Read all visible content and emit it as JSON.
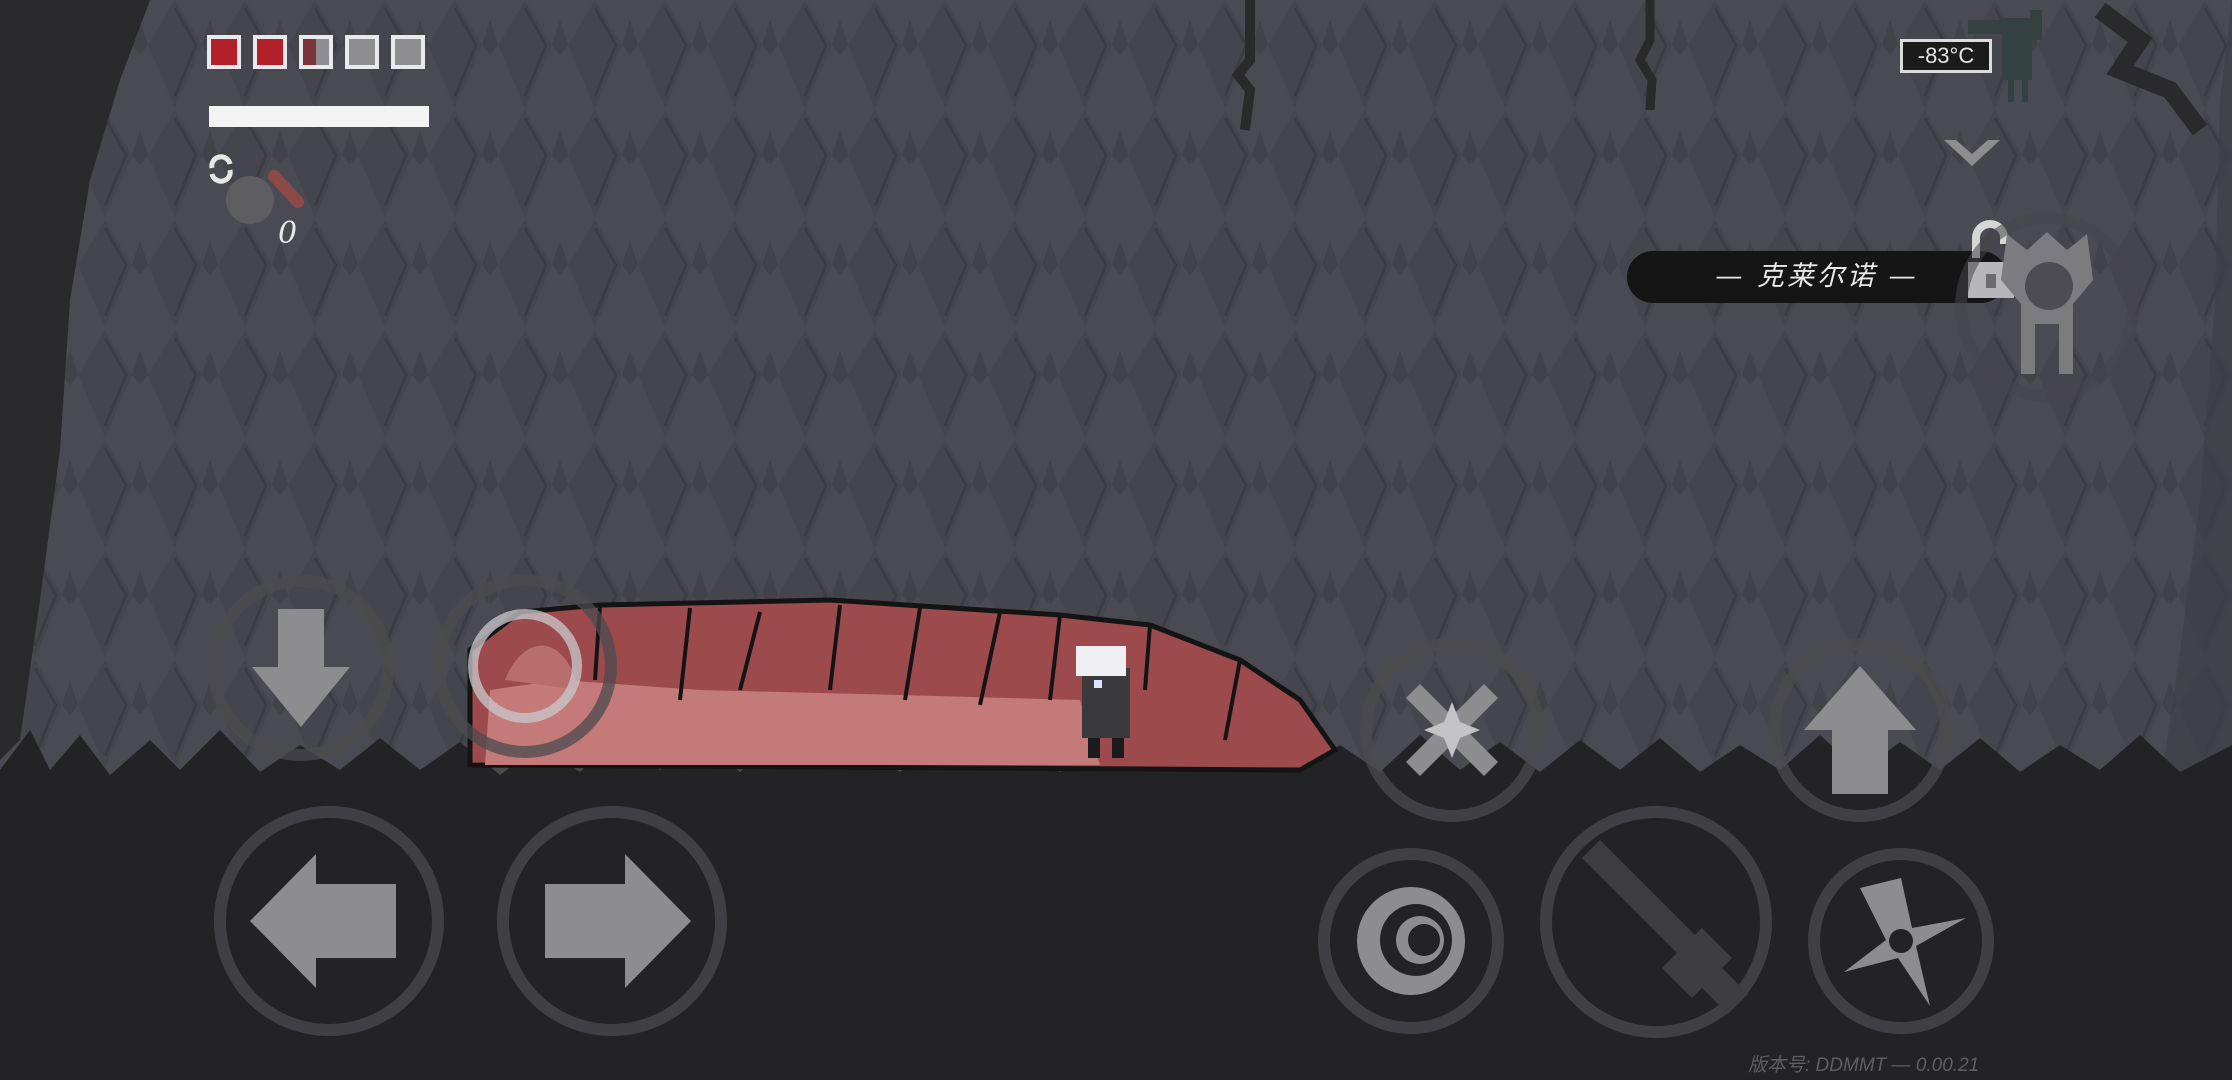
{
  "hud": {
    "health": {
      "max": 5,
      "full": 2,
      "half": 1
    },
    "stamina_fraction": 1.0,
    "item_counter": "0",
    "temperature": "-83°C"
  },
  "boss": {
    "name": "— 克莱尔诺 —"
  },
  "footer": {
    "version": "版本号: DDMMT — 0.00.21"
  },
  "controls": {
    "icons": [
      "swap-icon",
      "chevron-down-icon",
      "lock-open-icon",
      "moon-emblem-icon",
      "arrow-down-icon",
      "arrow-left-icon",
      "arrow-right-icon",
      "arrow-up-icon",
      "parry-icon",
      "dodge-spiral-icon",
      "sword-icon",
      "shuriken-icon"
    ]
  },
  "colors": {
    "health_full": "#b3202a",
    "health_empty": "#8e8e92",
    "ground": "#232325",
    "wall": "#4a4a52",
    "worm_body": "#9c4a4c",
    "control_ring": "#4b4b4f",
    "control_icon": "#8d8d8f"
  }
}
